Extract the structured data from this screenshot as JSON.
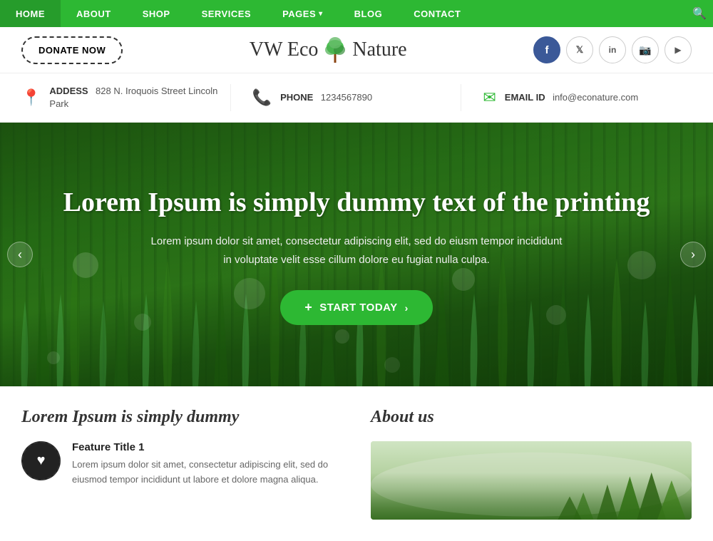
{
  "nav": {
    "items": [
      {
        "label": "HOME",
        "has_dropdown": false
      },
      {
        "label": "ABOUT",
        "has_dropdown": false
      },
      {
        "label": "SHOP",
        "has_dropdown": false
      },
      {
        "label": "SERVICES",
        "has_dropdown": false
      },
      {
        "label": "PAGES",
        "has_dropdown": true
      },
      {
        "label": "BLOG",
        "has_dropdown": false
      },
      {
        "label": "CONTACT",
        "has_dropdown": false
      }
    ]
  },
  "header": {
    "donate_label": "DONATE NOW",
    "logo_text_1": "VW Eco",
    "logo_text_2": "Nature",
    "social": [
      {
        "name": "facebook",
        "symbol": "f"
      },
      {
        "name": "twitter",
        "symbol": "t"
      },
      {
        "name": "linkedin",
        "symbol": "in"
      },
      {
        "name": "instagram",
        "symbol": "ig"
      },
      {
        "name": "youtube",
        "symbol": "▶"
      }
    ]
  },
  "info_bar": {
    "address_label": "ADDESS",
    "address_value": "828 N. Iroquois Street Lincoln Park",
    "phone_label": "PHONE",
    "phone_value": "1234567890",
    "email_label": "EMAIL ID",
    "email_value": "info@econature.com"
  },
  "hero": {
    "title": "Lorem Ipsum is simply dummy text of the printing",
    "description_1": "Lorem ipsum dolor sit amet, consectetur adipiscing elit, sed do eiusm tempor incididunt",
    "description_2": "in voluptate velit esse cillum dolore eu fugiat nulla culpa.",
    "cta_label": "START TODAY"
  },
  "bottom": {
    "left_title": "Lorem Ipsum is simply dummy",
    "right_title": "About us",
    "feature": {
      "title": "Feature Title 1",
      "description": "Lorem ipsum dolor sit amet, consectetur adipiscing elit, sed do eiusmod tempor incididunt ut labore et dolore magna aliqua."
    }
  }
}
